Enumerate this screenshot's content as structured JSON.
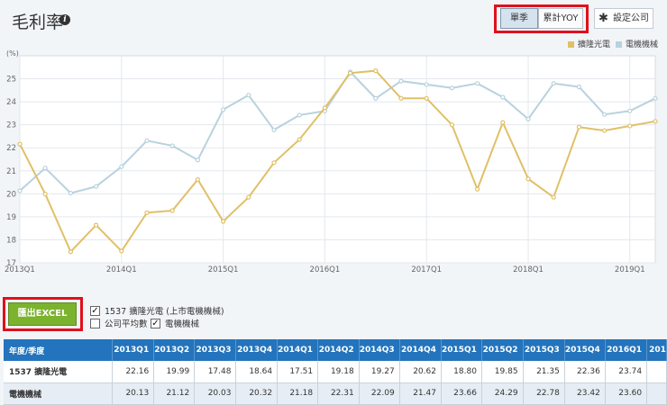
{
  "header": {
    "title": "毛利率",
    "info_icon": "info-icon",
    "toggle": {
      "single_label": "單季",
      "yoy_label": "累計YOY",
      "selected": "單季"
    },
    "settings_label": "設定公司",
    "settings_icon": "gear-icon"
  },
  "colors": {
    "series_company": "#e0c067",
    "series_industry": "#b8d2de",
    "highlight_frame": "#e0101c",
    "table_header": "#2374bc",
    "export_button": "#7bb32e"
  },
  "chart_data": {
    "type": "line",
    "unit_label": "(%)",
    "ylim": [
      17,
      26
    ],
    "y_ticks": [
      17,
      18,
      19,
      20,
      21,
      22,
      23,
      24,
      25
    ],
    "x_ticks": [
      "2013Q1",
      "2014Q1",
      "2015Q1",
      "2016Q1",
      "2017Q1",
      "2018Q1",
      "2019Q1"
    ],
    "x": [
      "2013Q1",
      "2013Q2",
      "2013Q3",
      "2013Q4",
      "2014Q1",
      "2014Q2",
      "2014Q3",
      "2014Q4",
      "2015Q1",
      "2015Q2",
      "2015Q3",
      "2015Q4",
      "2016Q1",
      "2016Q2",
      "2016Q3",
      "2016Q4",
      "2017Q1",
      "2017Q2",
      "2017Q3",
      "2017Q4",
      "2018Q1",
      "2018Q2",
      "2018Q3",
      "2018Q4",
      "2019Q1",
      "2019Q2"
    ],
    "grid": true,
    "legend_position": "top-right",
    "series": [
      {
        "name": "擴隆光電",
        "color": "#e0c067",
        "values": [
          22.16,
          19.99,
          17.48,
          18.64,
          17.51,
          19.18,
          19.27,
          20.62,
          18.8,
          19.85,
          21.35,
          22.36,
          23.74,
          25.25,
          25.35,
          24.15,
          24.15,
          23.0,
          20.2,
          23.1,
          20.65,
          19.85,
          22.9,
          22.75,
          22.95,
          23.15
        ]
      },
      {
        "name": "電機機械",
        "color": "#b8d2de",
        "values": [
          20.13,
          21.12,
          20.03,
          20.32,
          21.18,
          22.31,
          22.09,
          21.47,
          23.66,
          24.29,
          22.78,
          23.42,
          23.6,
          25.3,
          24.15,
          24.9,
          24.75,
          24.6,
          24.8,
          24.2,
          23.25,
          24.8,
          24.65,
          23.45,
          23.6,
          24.15
        ]
      }
    ]
  },
  "controls": {
    "export_label": "匯出EXCEL",
    "checkboxes": [
      {
        "label": "1537 擴隆光電 (上市電機機械)",
        "checked": true
      },
      {
        "label": "公司平均數",
        "checked": false
      },
      {
        "label": "電機機械",
        "checked": true
      }
    ]
  },
  "table": {
    "corner": "年度/季度",
    "columns": [
      "2013Q1",
      "2013Q2",
      "2013Q3",
      "2013Q4",
      "2014Q1",
      "2014Q2",
      "2014Q3",
      "2014Q4",
      "2015Q1",
      "2015Q2",
      "2015Q3",
      "2015Q4",
      "2016Q1",
      "201"
    ],
    "rows": [
      {
        "label": "1537 擴隆光電",
        "values": [
          "22.16",
          "19.99",
          "17.48",
          "18.64",
          "17.51",
          "19.18",
          "19.27",
          "20.62",
          "18.80",
          "19.85",
          "21.35",
          "22.36",
          "23.74",
          ""
        ]
      },
      {
        "label": "電機機械",
        "values": [
          "20.13",
          "21.12",
          "20.03",
          "20.32",
          "21.18",
          "22.31",
          "22.09",
          "21.47",
          "23.66",
          "24.29",
          "22.78",
          "23.42",
          "23.60",
          ""
        ]
      }
    ]
  }
}
